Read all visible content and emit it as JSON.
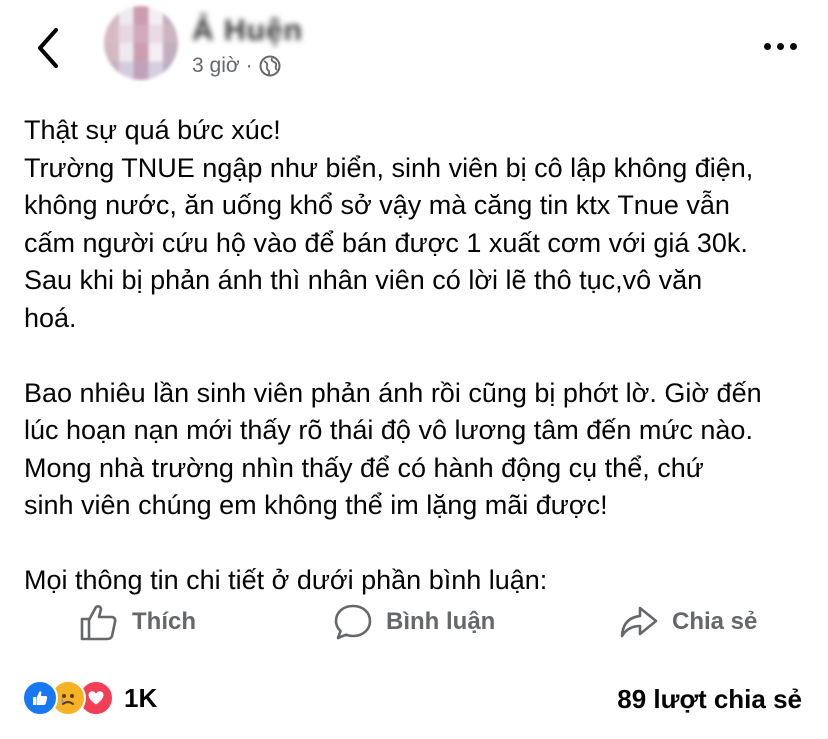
{
  "header": {
    "author_name": "Ả Huện",
    "time": "3 giờ",
    "separator": "·"
  },
  "post": {
    "paragraph1_lines": [
      "Thật sự quá bức xúc!",
      "Trường TNUE ngập như biển, sinh viên bị cô lập không điện,",
      "không nước, ăn uống khổ sở vậy mà căng tin ktx Tnue vẫn",
      "cấm người cứu hộ vào để bán được 1 xuất cơm với giá 30k.",
      "Sau khi bị phản ánh thì nhân viên có lời lẽ thô tục,vô văn",
      "hoá."
    ],
    "paragraph2_lines": [
      "Bao nhiêu lần sinh viên phản ánh rồi cũng bị phớt lờ. Giờ đến",
      "lúc hoạn nạn mới thấy rõ thái độ vô lương tâm đến mức nào.",
      "Mong nhà trường nhìn thấy để có hành động cụ thể, chứ",
      "sinh viên chúng em không thể im lặng mãi được!"
    ],
    "paragraph3_lines": [
      "Mọi thông tin chi tiết ở dưới phần bình luận:"
    ]
  },
  "actions": {
    "like_label": "Thích",
    "comment_label": "Bình luận",
    "share_label": "Chia sẻ"
  },
  "stats": {
    "reaction_count": "1K",
    "share_count": "89 lượt chia sẻ",
    "reaction_icons": [
      "like-icon",
      "sad-icon",
      "love-icon"
    ]
  },
  "colors": {
    "text": "#050505",
    "secondary": "#65676b",
    "like_blue": "#1877f2",
    "sad_yellow": "#f7b125",
    "love_red": "#f33e58"
  }
}
